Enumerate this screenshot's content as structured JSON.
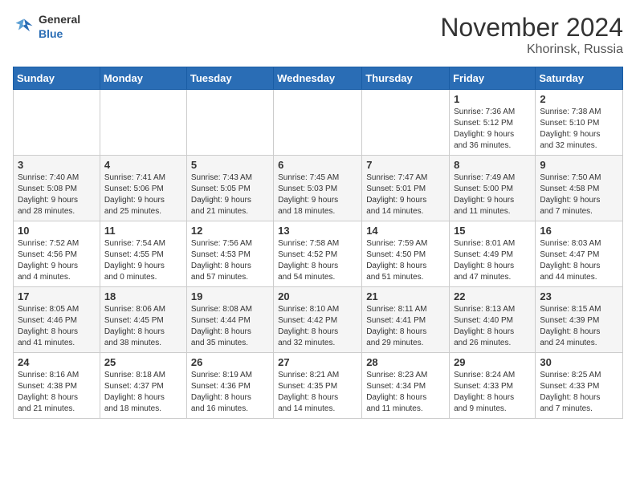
{
  "header": {
    "logo_general": "General",
    "logo_blue": "Blue",
    "month_title": "November 2024",
    "location": "Khorinsk, Russia"
  },
  "columns": [
    "Sunday",
    "Monday",
    "Tuesday",
    "Wednesday",
    "Thursday",
    "Friday",
    "Saturday"
  ],
  "weeks": [
    [
      {
        "day": "",
        "detail": ""
      },
      {
        "day": "",
        "detail": ""
      },
      {
        "day": "",
        "detail": ""
      },
      {
        "day": "",
        "detail": ""
      },
      {
        "day": "",
        "detail": ""
      },
      {
        "day": "1",
        "detail": "Sunrise: 7:36 AM\nSunset: 5:12 PM\nDaylight: 9 hours\nand 36 minutes."
      },
      {
        "day": "2",
        "detail": "Sunrise: 7:38 AM\nSunset: 5:10 PM\nDaylight: 9 hours\nand 32 minutes."
      }
    ],
    [
      {
        "day": "3",
        "detail": "Sunrise: 7:40 AM\nSunset: 5:08 PM\nDaylight: 9 hours\nand 28 minutes."
      },
      {
        "day": "4",
        "detail": "Sunrise: 7:41 AM\nSunset: 5:06 PM\nDaylight: 9 hours\nand 25 minutes."
      },
      {
        "day": "5",
        "detail": "Sunrise: 7:43 AM\nSunset: 5:05 PM\nDaylight: 9 hours\nand 21 minutes."
      },
      {
        "day": "6",
        "detail": "Sunrise: 7:45 AM\nSunset: 5:03 PM\nDaylight: 9 hours\nand 18 minutes."
      },
      {
        "day": "7",
        "detail": "Sunrise: 7:47 AM\nSunset: 5:01 PM\nDaylight: 9 hours\nand 14 minutes."
      },
      {
        "day": "8",
        "detail": "Sunrise: 7:49 AM\nSunset: 5:00 PM\nDaylight: 9 hours\nand 11 minutes."
      },
      {
        "day": "9",
        "detail": "Sunrise: 7:50 AM\nSunset: 4:58 PM\nDaylight: 9 hours\nand 7 minutes."
      }
    ],
    [
      {
        "day": "10",
        "detail": "Sunrise: 7:52 AM\nSunset: 4:56 PM\nDaylight: 9 hours\nand 4 minutes."
      },
      {
        "day": "11",
        "detail": "Sunrise: 7:54 AM\nSunset: 4:55 PM\nDaylight: 9 hours\nand 0 minutes."
      },
      {
        "day": "12",
        "detail": "Sunrise: 7:56 AM\nSunset: 4:53 PM\nDaylight: 8 hours\nand 57 minutes."
      },
      {
        "day": "13",
        "detail": "Sunrise: 7:58 AM\nSunset: 4:52 PM\nDaylight: 8 hours\nand 54 minutes."
      },
      {
        "day": "14",
        "detail": "Sunrise: 7:59 AM\nSunset: 4:50 PM\nDaylight: 8 hours\nand 51 minutes."
      },
      {
        "day": "15",
        "detail": "Sunrise: 8:01 AM\nSunset: 4:49 PM\nDaylight: 8 hours\nand 47 minutes."
      },
      {
        "day": "16",
        "detail": "Sunrise: 8:03 AM\nSunset: 4:47 PM\nDaylight: 8 hours\nand 44 minutes."
      }
    ],
    [
      {
        "day": "17",
        "detail": "Sunrise: 8:05 AM\nSunset: 4:46 PM\nDaylight: 8 hours\nand 41 minutes."
      },
      {
        "day": "18",
        "detail": "Sunrise: 8:06 AM\nSunset: 4:45 PM\nDaylight: 8 hours\nand 38 minutes."
      },
      {
        "day": "19",
        "detail": "Sunrise: 8:08 AM\nSunset: 4:44 PM\nDaylight: 8 hours\nand 35 minutes."
      },
      {
        "day": "20",
        "detail": "Sunrise: 8:10 AM\nSunset: 4:42 PM\nDaylight: 8 hours\nand 32 minutes."
      },
      {
        "day": "21",
        "detail": "Sunrise: 8:11 AM\nSunset: 4:41 PM\nDaylight: 8 hours\nand 29 minutes."
      },
      {
        "day": "22",
        "detail": "Sunrise: 8:13 AM\nSunset: 4:40 PM\nDaylight: 8 hours\nand 26 minutes."
      },
      {
        "day": "23",
        "detail": "Sunrise: 8:15 AM\nSunset: 4:39 PM\nDaylight: 8 hours\nand 24 minutes."
      }
    ],
    [
      {
        "day": "24",
        "detail": "Sunrise: 8:16 AM\nSunset: 4:38 PM\nDaylight: 8 hours\nand 21 minutes."
      },
      {
        "day": "25",
        "detail": "Sunrise: 8:18 AM\nSunset: 4:37 PM\nDaylight: 8 hours\nand 18 minutes."
      },
      {
        "day": "26",
        "detail": "Sunrise: 8:19 AM\nSunset: 4:36 PM\nDaylight: 8 hours\nand 16 minutes."
      },
      {
        "day": "27",
        "detail": "Sunrise: 8:21 AM\nSunset: 4:35 PM\nDaylight: 8 hours\nand 14 minutes."
      },
      {
        "day": "28",
        "detail": "Sunrise: 8:23 AM\nSunset: 4:34 PM\nDaylight: 8 hours\nand 11 minutes."
      },
      {
        "day": "29",
        "detail": "Sunrise: 8:24 AM\nSunset: 4:33 PM\nDaylight: 8 hours\nand 9 minutes."
      },
      {
        "day": "30",
        "detail": "Sunrise: 8:25 AM\nSunset: 4:33 PM\nDaylight: 8 hours\nand 7 minutes."
      }
    ]
  ]
}
